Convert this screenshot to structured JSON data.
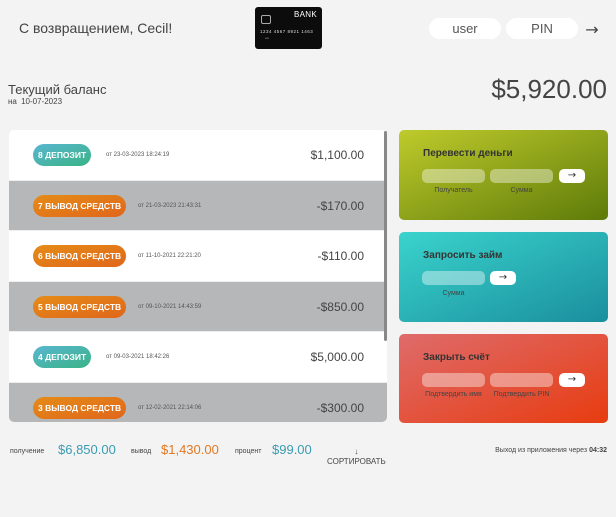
{
  "nav": {
    "welcome": "С возвращением, Cecil!",
    "logo": {
      "bank": "BANK",
      "number": "1234  4567  8921  1463",
      "sub": "••••"
    },
    "user_placeholder": "user",
    "pin_placeholder": "PIN",
    "login_arrow": "→"
  },
  "balance": {
    "label": "Текущий баланс",
    "date_prefix": "на",
    "date": "10-07-2023",
    "value": "$5,920.00"
  },
  "movements": [
    {
      "type": "deposit",
      "label": "8 ДЕПОЗИТ",
      "date": "от 23-03-2023 18:24:19",
      "value": "$1,100.00"
    },
    {
      "type": "withdrawal",
      "label": "7 ВЫВОД СРЕДСТВ",
      "date": "от 21-03-2023 21:43:31",
      "value": "-$170.00"
    },
    {
      "type": "withdrawal",
      "label": "6 ВЫВОД СРЕДСТВ",
      "date": "от 11-10-2021 22:21:20",
      "value": "-$110.00"
    },
    {
      "type": "withdrawal",
      "label": "5 ВЫВОД СРЕДСТВ",
      "date": "от 09-10-2021 14:43:59",
      "value": "-$850.00"
    },
    {
      "type": "deposit",
      "label": "4 ДЕПОЗИТ",
      "date": "от 09-03-2021 18:42:26",
      "value": "$5,000.00"
    },
    {
      "type": "withdrawal",
      "label": "3 ВЫВОД СРЕДСТВ",
      "date": "от 12-02-2021 22:14:06",
      "value": "-$300.00"
    }
  ],
  "operations": {
    "transfer": {
      "title": "Перевести деньги",
      "label_to": "Получатель",
      "label_amount": "Сумма",
      "button": "→"
    },
    "loan": {
      "title": "Запросить займ",
      "label_amount": "Сумма",
      "button": "→"
    },
    "close": {
      "title": "Закрыть счёт",
      "label_user": "Подтвердить имя",
      "label_pin": "Подтвердить PIN",
      "button": "→"
    }
  },
  "summary": {
    "in_label": "получение",
    "in_value": "$6,850.00",
    "out_label": "вывод",
    "out_value": "$1,430.00",
    "interest_label": "процент",
    "interest_value": "$99.00",
    "sort_arrow": "↓",
    "sort_label": "СОРТИРОВАТЬ"
  },
  "logout": {
    "text": "Выход из приложения через",
    "timer": "04:32"
  },
  "colors": {
    "deposit": "#39b385",
    "withdrawal": "#e0661b",
    "transfer": "#9db31d",
    "loan": "#2cb8c0",
    "close": "#e35531",
    "alt_row": "#b5b7b9"
  }
}
